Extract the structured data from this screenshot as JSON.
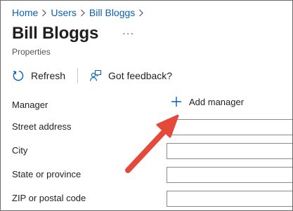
{
  "breadcrumb": {
    "items": [
      "Home",
      "Users",
      "Bill Bloggs"
    ]
  },
  "header": {
    "title": "Bill Bloggs",
    "more": "···",
    "subtitle": "Properties"
  },
  "toolbar": {
    "refresh_label": "Refresh",
    "feedback_label": "Got feedback?"
  },
  "form": {
    "manager_label": "Manager",
    "add_manager_label": "Add manager",
    "fields": [
      {
        "label": "Street address",
        "value": ""
      },
      {
        "label": "City",
        "value": ""
      },
      {
        "label": "State or province",
        "value": ""
      },
      {
        "label": "ZIP or postal code",
        "value": ""
      }
    ]
  },
  "colors": {
    "link": "#0a5fb4",
    "accent": "#0a5fb4",
    "arrow": "#e5493a"
  }
}
